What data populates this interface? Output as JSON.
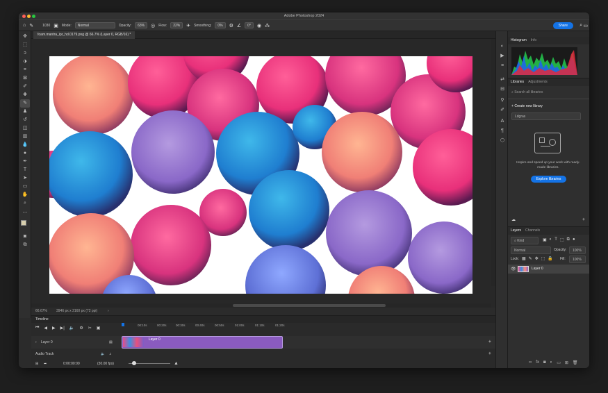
{
  "window": {
    "title": "Adobe Photoshop 2024"
  },
  "options_bar": {
    "brush_size": "1030",
    "mode_label": "Mode:",
    "mode_value": "Normal",
    "opacity_label": "Opacity:",
    "opacity_value": "63%",
    "flow_label": "Flow:",
    "flow_value": "22%",
    "smoothing_label": "Smoothing:",
    "smoothing_value": "0%",
    "angle_value": "0°",
    "share_label": "Share"
  },
  "document": {
    "tab_label": "foam.mantra_ipr_hd.0179.png @ 66.7% (Layer 0, RGB/16) *",
    "zoom": "66.67%",
    "dimensions": "3946 px x 2160 px (72 ppi)"
  },
  "timeline": {
    "title": "Timeline",
    "ruler_ticks": [
      "00:10s",
      "00:20s",
      "00:30s",
      "00:40s",
      "00:50s",
      "01:00s",
      "01:10s",
      "01:20s"
    ],
    "layer_track_label": "Layer 0",
    "clip_label": "Layer 0",
    "audio_track_label": "Audio Track",
    "timecode": "0:00:00:00",
    "fps": "(30.00 fps)"
  },
  "panels": {
    "histogram": {
      "tab": "Histogram",
      "tab2": "Info"
    },
    "libraries": {
      "tab": "Libraries",
      "tab2": "Adjustments",
      "search_placeholder": "Search all libraries",
      "create_label": "Create new library",
      "library_name": "Ldgras",
      "promo_text": "Inspire and speed up your work with ready-made libraries.",
      "explore_label": "Explore libraries"
    },
    "layers": {
      "tab": "Layers",
      "tab2": "Channels",
      "filter_value": "Kind",
      "blend_value": "Normal",
      "opacity_label": "Opacity:",
      "opacity_value": "100%",
      "lock_label": "Lock:",
      "fill_label": "Fill:",
      "fill_value": "100%",
      "layer_name": "Layer 0"
    }
  },
  "colors": {
    "accent": "#1473e6",
    "clip": "#8a5bbf"
  }
}
